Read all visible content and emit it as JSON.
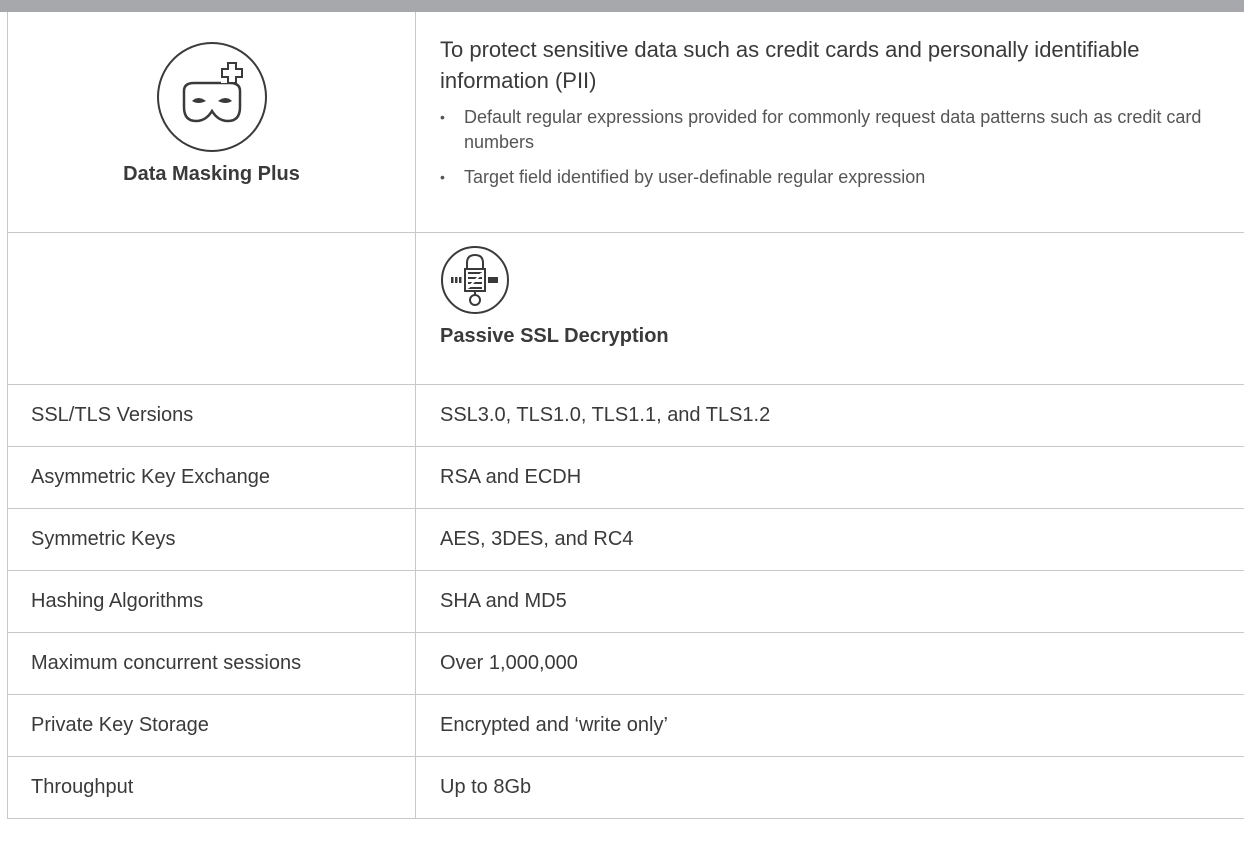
{
  "feature": {
    "icon": "mask-plus-icon",
    "name": "Data Masking Plus",
    "description": "To protect sensitive data such as credit cards and personally identifiable information (PII)",
    "bullets": [
      "Default regular expressions provided for commonly request data patterns such as credit card numbers",
      "Target field identified by user-definable regular expression"
    ]
  },
  "section": {
    "icon": "ssl-lock-icon",
    "title": "Passive SSL Decryption"
  },
  "specs": [
    {
      "label": "SSL/TLS Versions",
      "value": "SSL3.0, TLS1.0, TLS1.1, and TLS1.2"
    },
    {
      "label": "Asymmetric Key Exchange",
      "value": "RSA and ECDH"
    },
    {
      "label": "Symmetric Keys",
      "value": "AES, 3DES, and RC4"
    },
    {
      "label": "Hashing Algorithms",
      "value": "SHA and MD5"
    },
    {
      "label": "Maximum concurrent sessions",
      "value": "Over 1,000,000"
    },
    {
      "label": "Private Key Storage",
      "value": "Encrypted and ‘write only’"
    },
    {
      "label": "Throughput",
      "value": "Up to 8Gb"
    }
  ],
  "colors": {
    "border": "#c8c8c8",
    "top_bar": "#a7a8ac",
    "text": "#3a3a3a"
  }
}
